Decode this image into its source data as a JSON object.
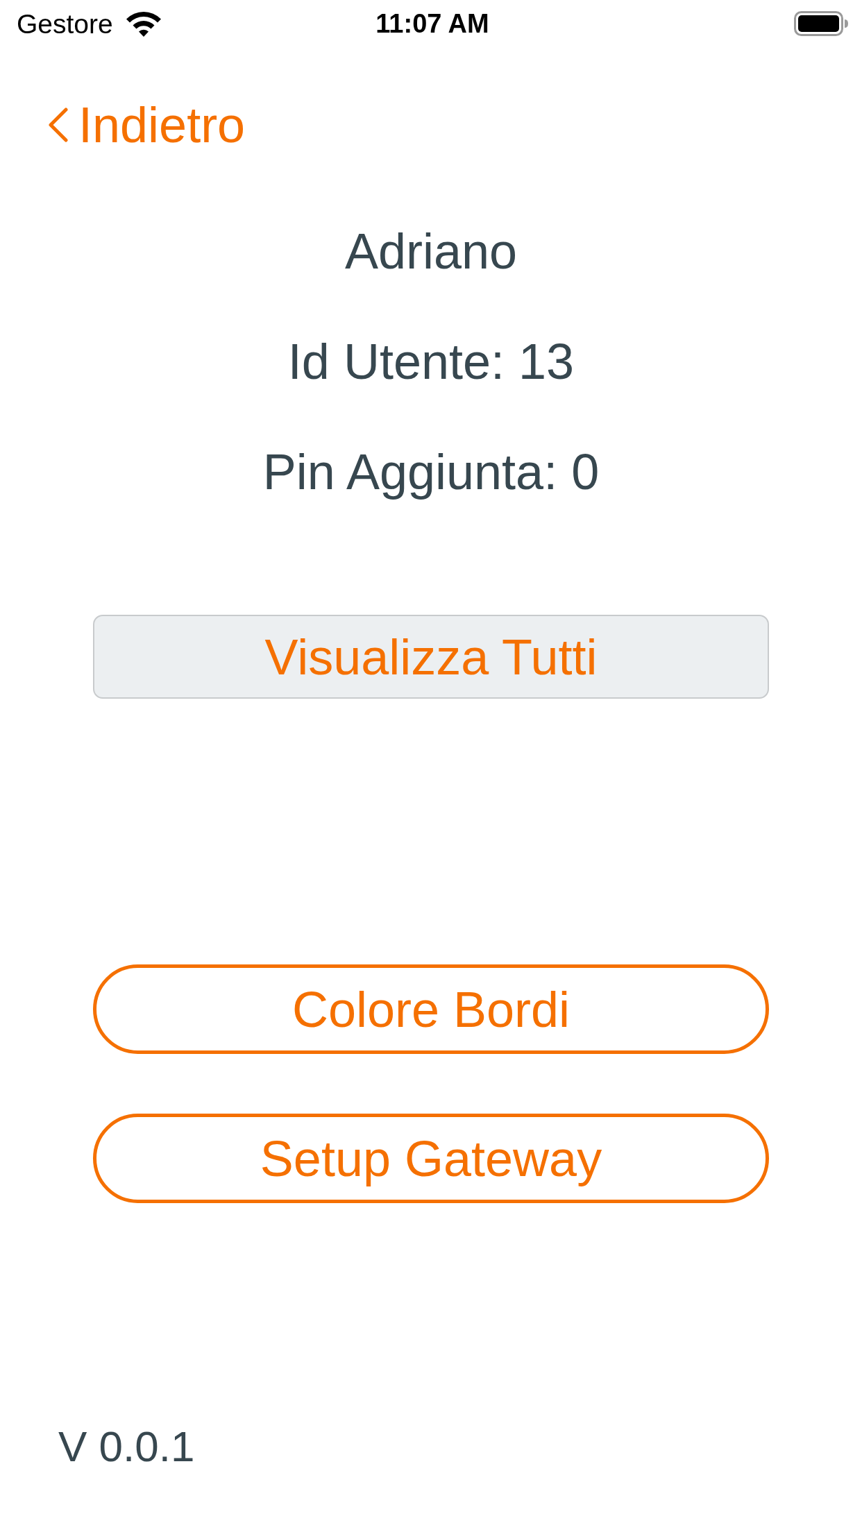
{
  "status_bar": {
    "carrier": "Gestore",
    "time": "11:07 AM"
  },
  "nav": {
    "back_label": "Indietro"
  },
  "profile": {
    "name": "Adriano",
    "user_id": "Id Utente: 13",
    "pin": "Pin Aggiunta: 0"
  },
  "view_all_button": {
    "label": "Visualizza Tutti"
  },
  "settings_buttons": [
    {
      "label": "Colore Bordi"
    },
    {
      "label": "Setup Gateway"
    }
  ],
  "version": "V 0.0.1"
}
